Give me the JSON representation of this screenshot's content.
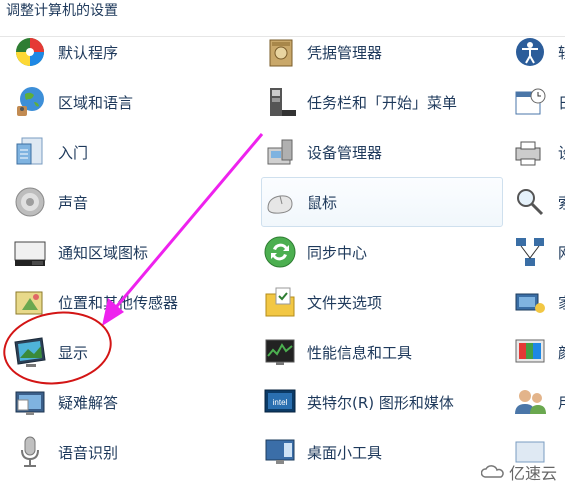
{
  "header": {
    "title": "调整计算机的设置"
  },
  "column1": [
    {
      "label": "默认程序",
      "icon": "default-programs-icon"
    },
    {
      "label": "区域和语言",
      "icon": "region-language-icon"
    },
    {
      "label": "入门",
      "icon": "getting-started-icon"
    },
    {
      "label": "声音",
      "icon": "sound-icon"
    },
    {
      "label": "通知区域图标",
      "icon": "notification-area-icon"
    },
    {
      "label": "位置和其他传感器",
      "icon": "location-sensors-icon"
    },
    {
      "label": "显示",
      "icon": "display-icon"
    },
    {
      "label": "疑难解答",
      "icon": "troubleshooting-icon"
    },
    {
      "label": "语音识别",
      "icon": "speech-recognition-icon"
    }
  ],
  "column2": [
    {
      "label": "凭据管理器",
      "icon": "credential-manager-icon"
    },
    {
      "label": "任务栏和「开始」菜单",
      "icon": "taskbar-start-icon"
    },
    {
      "label": "设备管理器",
      "icon": "device-manager-icon"
    },
    {
      "label": "鼠标",
      "icon": "mouse-icon"
    },
    {
      "label": "同步中心",
      "icon": "sync-center-icon"
    },
    {
      "label": "文件夹选项",
      "icon": "folder-options-icon"
    },
    {
      "label": "性能信息和工具",
      "icon": "performance-icon"
    },
    {
      "label": "英特尔(R) 图形和媒体",
      "icon": "intel-graphics-icon"
    },
    {
      "label": "桌面小工具",
      "icon": "desktop-gadgets-icon"
    }
  ],
  "column3": [
    {
      "label": "轻",
      "icon": "ease-of-access-icon"
    },
    {
      "label": "日",
      "icon": "date-time-icon"
    },
    {
      "label": "设",
      "icon": "devices-printers-icon"
    },
    {
      "label": "索",
      "icon": "indexing-icon"
    },
    {
      "label": "网",
      "icon": "network-icon"
    },
    {
      "label": "家",
      "icon": "homegroup-icon"
    },
    {
      "label": "颜",
      "icon": "color-management-icon"
    },
    {
      "label": "用",
      "icon": "user-accounts-icon"
    },
    {
      "label": "",
      "icon": "misc-icon"
    }
  ],
  "annotations": {
    "arrow_color": "#ee22ee",
    "circle_color": "#d31515"
  },
  "watermark": {
    "text": "亿速云"
  }
}
